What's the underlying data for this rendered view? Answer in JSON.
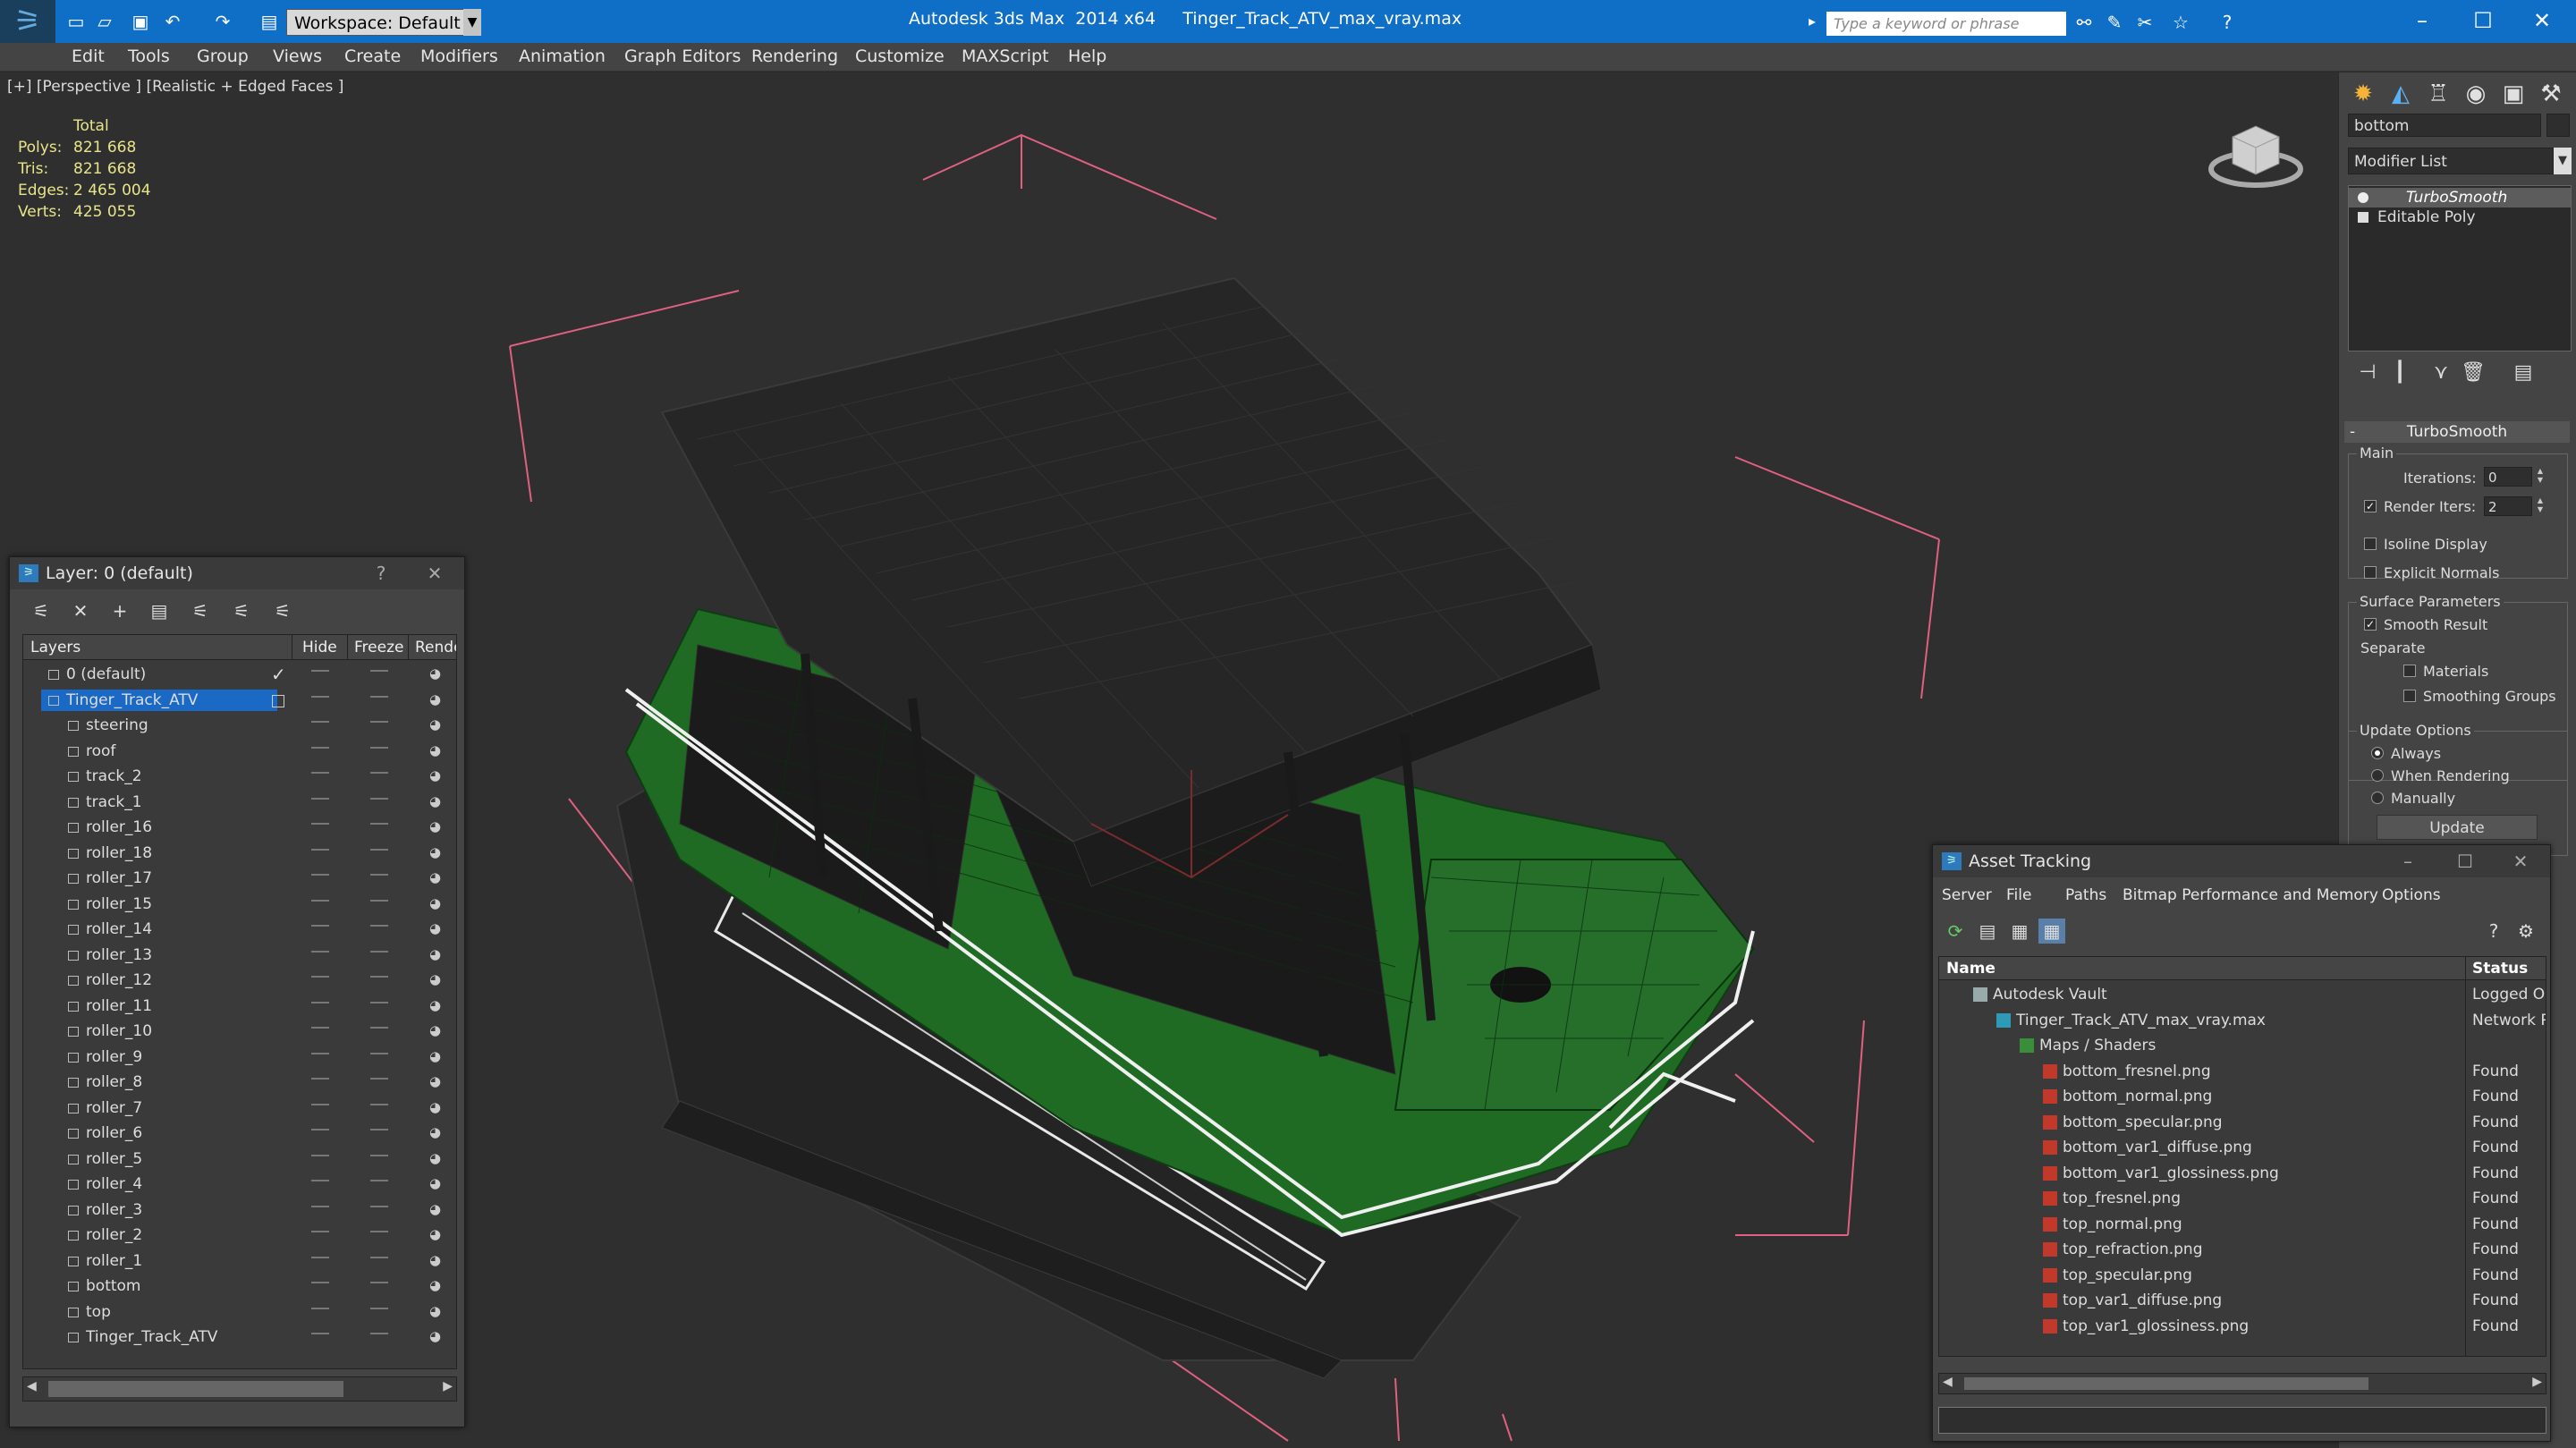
{
  "colors": {
    "titlebar": "#0f6fc6",
    "selection": "#1a69c4",
    "stats_text": "#e8e48a",
    "vehicle_green": "#1f6b24",
    "bbox_pink": "#e06080"
  },
  "titlebar": {
    "workspace": "Workspace: Default",
    "title": "Autodesk 3ds Max  2014 x64     Tinger_Track_ATV_max_vray.max",
    "search_placeholder": "Type a keyword or phrase"
  },
  "menu": [
    "Edit",
    "Tools",
    "Group",
    "Views",
    "Create",
    "Modifiers",
    "Animation",
    "Graph Editors",
    "Rendering",
    "Customize",
    "MAXScript",
    "Help"
  ],
  "viewport": {
    "label": "[+] [Perspective ] [Realistic + Edged Faces ]",
    "stats": {
      "header": "Total",
      "rows": [
        {
          "label": "Polys:",
          "value": "821 668"
        },
        {
          "label": "Tris:",
          "value": "821 668"
        },
        {
          "label": "Edges:",
          "value": "2 465 004"
        },
        {
          "label": "Verts:",
          "value": "425 055"
        }
      ]
    }
  },
  "command_panel": {
    "object_name": "bottom",
    "modifier_list": "Modifier List",
    "stack": [
      "TurboSmooth",
      "Editable Poly"
    ],
    "rollout_title": "TurboSmooth",
    "main_group": "Main",
    "iterations_label": "Iterations:",
    "iterations_value": "0",
    "render_iters_label": "Render Iters:",
    "render_iters_value": "2",
    "render_iters_checked": true,
    "isoline_display": "Isoline Display",
    "explicit_normals": "Explicit Normals",
    "surface_group": "Surface Parameters",
    "smooth_result": "Smooth Result",
    "separate": "Separate",
    "materials": "Materials",
    "smoothing_groups": "Smoothing Groups",
    "update_group": "Update Options",
    "always": "Always",
    "when_rendering": "When Rendering",
    "manually": "Manually",
    "update_button": "Update"
  },
  "layer_window": {
    "title": "Layer: 0 (default)",
    "help": "?",
    "columns": {
      "layers": "Layers",
      "hide": "Hide",
      "freeze": "Freeze",
      "render": "Render"
    },
    "layers": [
      {
        "name": "0 (default)",
        "level": 0,
        "current": true
      },
      {
        "name": "Tinger_Track_ATV",
        "level": 0,
        "selected": true
      },
      {
        "name": "steering",
        "level": 1
      },
      {
        "name": "roof",
        "level": 1
      },
      {
        "name": "track_2",
        "level": 1
      },
      {
        "name": "track_1",
        "level": 1
      },
      {
        "name": "roller_16",
        "level": 1
      },
      {
        "name": "roller_18",
        "level": 1
      },
      {
        "name": "roller_17",
        "level": 1
      },
      {
        "name": "roller_15",
        "level": 1
      },
      {
        "name": "roller_14",
        "level": 1
      },
      {
        "name": "roller_13",
        "level": 1
      },
      {
        "name": "roller_12",
        "level": 1
      },
      {
        "name": "roller_11",
        "level": 1
      },
      {
        "name": "roller_10",
        "level": 1
      },
      {
        "name": "roller_9",
        "level": 1
      },
      {
        "name": "roller_8",
        "level": 1
      },
      {
        "name": "roller_7",
        "level": 1
      },
      {
        "name": "roller_6",
        "level": 1
      },
      {
        "name": "roller_5",
        "level": 1
      },
      {
        "name": "roller_4",
        "level": 1
      },
      {
        "name": "roller_3",
        "level": 1
      },
      {
        "name": "roller_2",
        "level": 1
      },
      {
        "name": "roller_1",
        "level": 1
      },
      {
        "name": "bottom",
        "level": 1
      },
      {
        "name": "top",
        "level": 1
      },
      {
        "name": "Tinger_Track_ATV",
        "level": 1
      }
    ]
  },
  "asset_window": {
    "title": "Asset Tracking",
    "menu": [
      "Server",
      "File",
      "Paths",
      "Bitmap Performance and Memory",
      "Options"
    ],
    "columns": {
      "name": "Name",
      "status": "Status"
    },
    "rows": [
      {
        "name": "Autodesk Vault",
        "status": "Logged Ou",
        "level": 0,
        "icon": "vault-icon"
      },
      {
        "name": "Tinger_Track_ATV_max_vray.max",
        "status": "Network P",
        "level": 1,
        "icon": "max-file-icon"
      },
      {
        "name": "Maps / Shaders",
        "status": "",
        "level": 2,
        "icon": "maps-folder-icon"
      },
      {
        "name": "bottom_fresnel.png",
        "status": "Found",
        "level": 3,
        "icon": "png-file-icon"
      },
      {
        "name": "bottom_normal.png",
        "status": "Found",
        "level": 3,
        "icon": "png-file-icon"
      },
      {
        "name": "bottom_specular.png",
        "status": "Found",
        "level": 3,
        "icon": "png-file-icon"
      },
      {
        "name": "bottom_var1_diffuse.png",
        "status": "Found",
        "level": 3,
        "icon": "png-file-icon"
      },
      {
        "name": "bottom_var1_glossiness.png",
        "status": "Found",
        "level": 3,
        "icon": "png-file-icon"
      },
      {
        "name": "top_fresnel.png",
        "status": "Found",
        "level": 3,
        "icon": "png-file-icon"
      },
      {
        "name": "top_normal.png",
        "status": "Found",
        "level": 3,
        "icon": "png-file-icon"
      },
      {
        "name": "top_refraction.png",
        "status": "Found",
        "level": 3,
        "icon": "png-file-icon"
      },
      {
        "name": "top_specular.png",
        "status": "Found",
        "level": 3,
        "icon": "png-file-icon"
      },
      {
        "name": "top_var1_diffuse.png",
        "status": "Found",
        "level": 3,
        "icon": "png-file-icon"
      },
      {
        "name": "top_var1_glossiness.png",
        "status": "Found",
        "level": 3,
        "icon": "png-file-icon"
      }
    ]
  }
}
